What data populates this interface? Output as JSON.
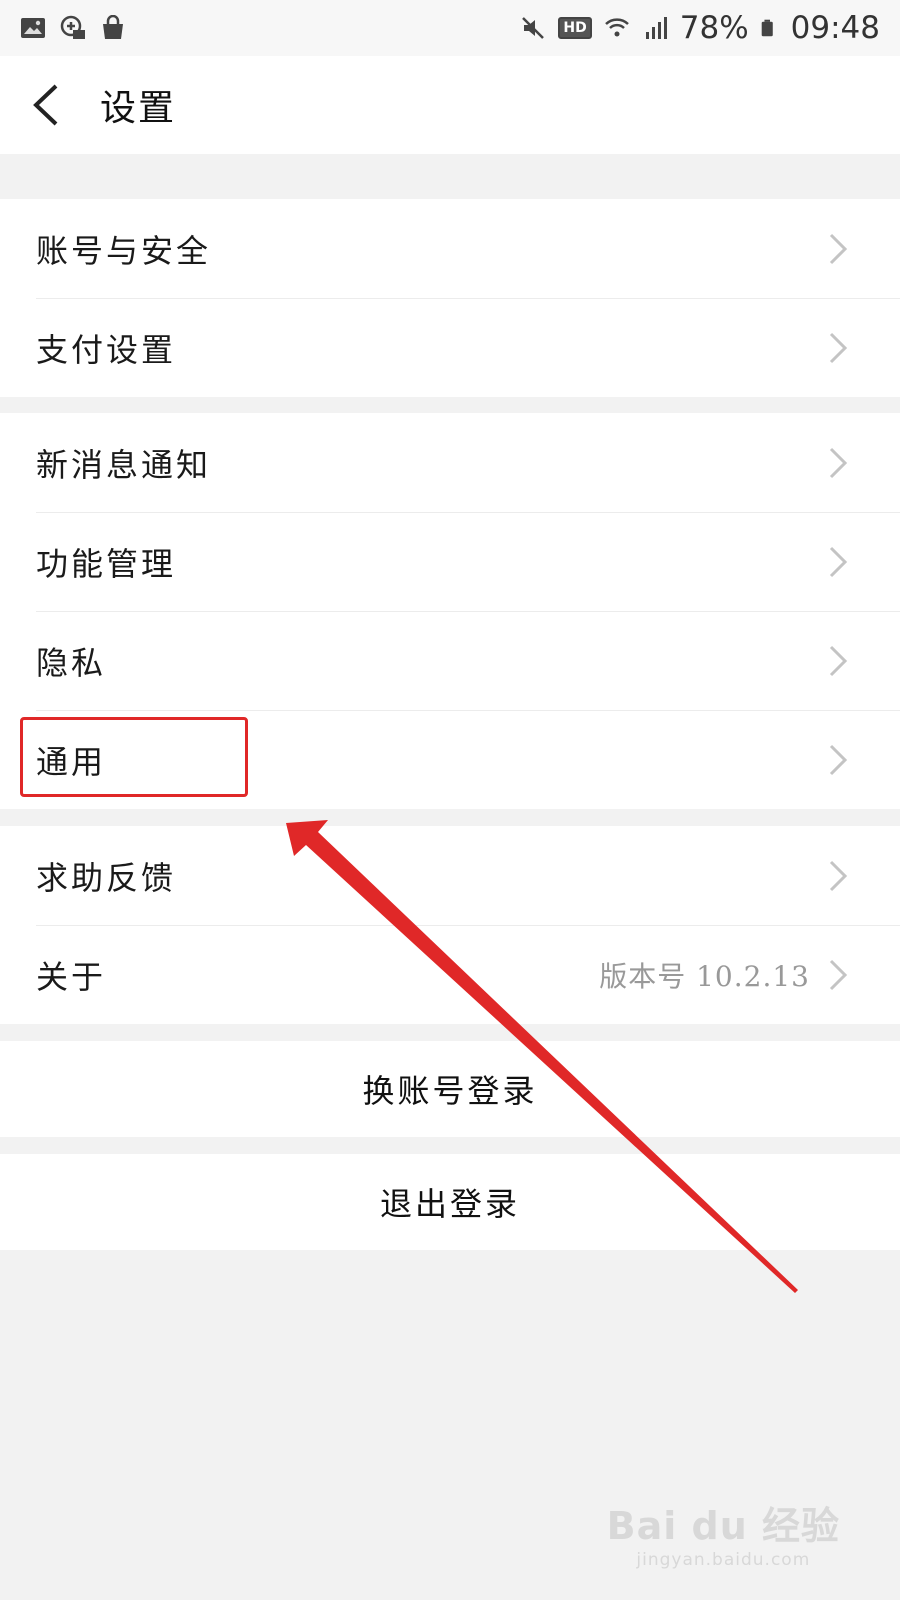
{
  "status_bar": {
    "left_icons": [
      "image-icon",
      "vpn-mail-icon",
      "shopping-bag-icon"
    ],
    "right_icons": [
      "mute-icon",
      "hd-icon",
      "wifi-icon",
      "signal-4g-icon",
      "battery-icon"
    ],
    "hd_label": "HD",
    "battery_percent": "78%",
    "time": "09:48"
  },
  "navbar": {
    "back_icon": "chevron-left-icon",
    "title": "设置"
  },
  "groups": [
    {
      "items": [
        {
          "label": "账号与安全"
        },
        {
          "label": "支付设置"
        }
      ]
    },
    {
      "items": [
        {
          "label": "新消息通知"
        },
        {
          "label": "功能管理"
        },
        {
          "label": "隐私"
        },
        {
          "label": "通用"
        }
      ]
    },
    {
      "items": [
        {
          "label": "求助反馈"
        },
        {
          "label": "关于",
          "value": "版本号 10.2.13"
        }
      ]
    }
  ],
  "actions": {
    "switch_account": "换账号登录",
    "logout": "退出登录"
  },
  "annotation": {
    "highlight_color": "#e02828",
    "highlighted_item": "通用"
  },
  "watermark": {
    "logo": "Bai du 经验",
    "url": "jingyan.baidu.com"
  }
}
